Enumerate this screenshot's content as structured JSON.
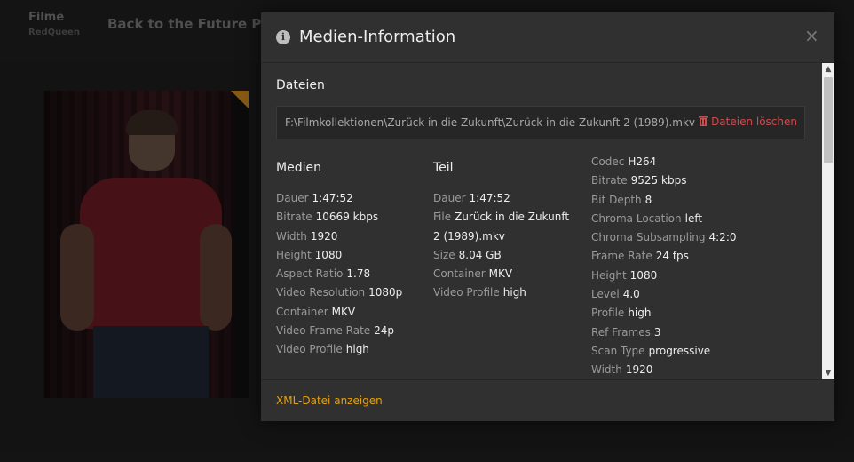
{
  "background": {
    "library_title": "Filme",
    "library_server": "RedQueen",
    "movie_title": "Back to the Future Part II"
  },
  "modal": {
    "title": "Medien-Information",
    "close_label": "×",
    "files_section_title": "Dateien",
    "file_path": "F:\\Filmkollektionen\\Zurück in die Zukunft\\Zurück in die Zukunft 2 (1989).mkv",
    "delete_label": "Dateien löschen",
    "footer_link": "XML-Datei anzeigen",
    "media": {
      "heading": "Medien",
      "rows": [
        {
          "label": "Dauer",
          "value": "1:47:52"
        },
        {
          "label": "Bitrate",
          "value": "10669 kbps"
        },
        {
          "label": "Width",
          "value": "1920"
        },
        {
          "label": "Height",
          "value": "1080"
        },
        {
          "label": "Aspect Ratio",
          "value": "1.78"
        },
        {
          "label": "Video Resolution",
          "value": "1080p"
        },
        {
          "label": "Container",
          "value": "MKV"
        },
        {
          "label": "Video Frame Rate",
          "value": "24p"
        },
        {
          "label": "Video Profile",
          "value": "high"
        }
      ]
    },
    "part": {
      "heading": "Teil",
      "rows": [
        {
          "label": "Dauer",
          "value": "1:47:52"
        },
        {
          "label": "File",
          "value": "Zurück in die Zukunft 2 (1989).mkv"
        },
        {
          "label": "Size",
          "value": "8.04 GB"
        },
        {
          "label": "Container",
          "value": "MKV"
        },
        {
          "label": "Video Profile",
          "value": "high"
        }
      ]
    },
    "stream": {
      "rows": [
        {
          "label": "Codec",
          "value": "H264"
        },
        {
          "label": "Bitrate",
          "value": "9525 kbps"
        },
        {
          "label": "Bit Depth",
          "value": "8"
        },
        {
          "label": "Chroma Location",
          "value": "left"
        },
        {
          "label": "Chroma Subsampling",
          "value": "4:2:0"
        },
        {
          "label": "Frame Rate",
          "value": "24 fps"
        },
        {
          "label": "Height",
          "value": "1080"
        },
        {
          "label": "Level",
          "value": "4.0"
        },
        {
          "label": "Profile",
          "value": "high"
        },
        {
          "label": "Ref Frames",
          "value": "3"
        },
        {
          "label": "Scan Type",
          "value": "progressive"
        },
        {
          "label": "Width",
          "value": "1920"
        }
      ]
    }
  },
  "colors": {
    "accent": "#e5a00d",
    "danger": "#d04b4b",
    "modal_bg": "#303030"
  }
}
